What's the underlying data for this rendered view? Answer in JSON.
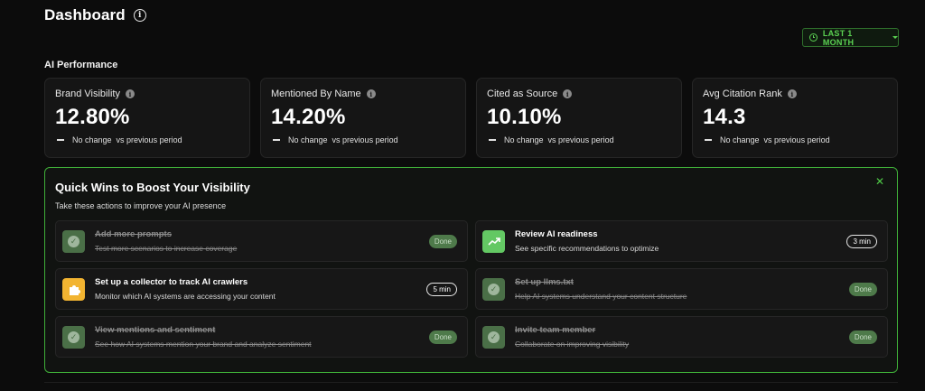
{
  "header": {
    "title": "Dashboard",
    "info_icon": "info-icon"
  },
  "period": {
    "label": "LAST 1 MONTH",
    "icon": "clock-icon",
    "accent": "#5bd152"
  },
  "section_label": "AI Performance",
  "stats": [
    {
      "label": "Brand Visibility",
      "value": "12.80%",
      "change": "No change",
      "suffix": "vs previous period"
    },
    {
      "label": "Mentioned By Name",
      "value": "14.20%",
      "change": "No change",
      "suffix": "vs previous period"
    },
    {
      "label": "Cited as Source",
      "value": "10.10%",
      "change": "No change",
      "suffix": "vs previous period"
    },
    {
      "label": "Avg Citation Rank",
      "value": "14.3",
      "change": "No change",
      "suffix": "vs previous period"
    }
  ],
  "quick_wins": {
    "title": "Quick Wins to Boost Your Visibility",
    "subtitle": "Take these actions to improve your AI presence",
    "close_symbol": "✕",
    "tasks": [
      {
        "title": "Add more prompts",
        "desc": "Test more scenarios to increase coverage",
        "status": "Done",
        "done": true,
        "icon": "check-icon"
      },
      {
        "title": "Review AI readiness",
        "desc": "See specific recommendations to optimize",
        "status": "3 min",
        "done": false,
        "icon": "trend-up-icon"
      },
      {
        "title": "Set up a collector to track AI crawlers",
        "desc": "Monitor which AI systems are accessing your content",
        "status": "5 min",
        "done": false,
        "icon": "puzzle-icon"
      },
      {
        "title": "Set up llms.txt",
        "desc": "Help AI systems understand your content structure",
        "status": "Done",
        "done": true,
        "icon": "check-icon"
      },
      {
        "title": "View mentions and sentiment",
        "desc": "See how AI systems mention your brand and analyze sentiment",
        "status": "Done",
        "done": true,
        "icon": "check-icon"
      },
      {
        "title": "Invite team member",
        "desc": "Collaborate on improving visibility",
        "status": "Done",
        "done": true,
        "icon": "check-icon"
      }
    ]
  }
}
